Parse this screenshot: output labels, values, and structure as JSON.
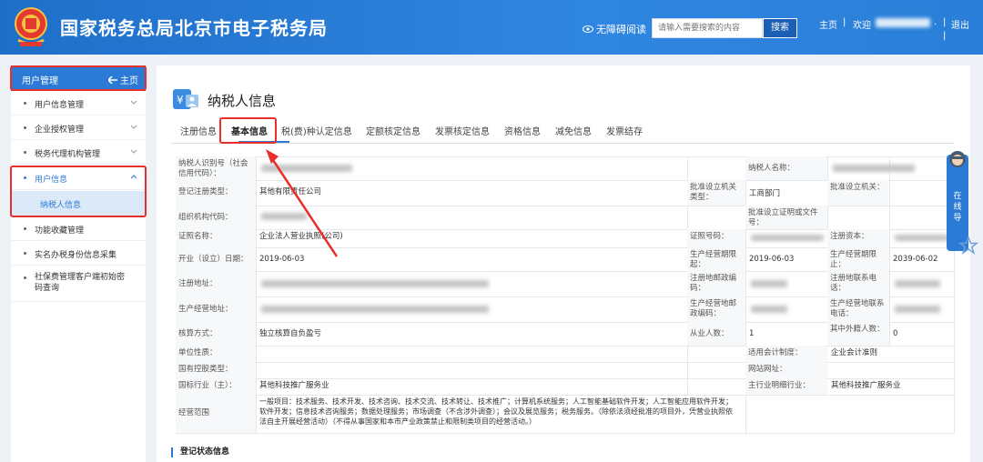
{
  "header": {
    "site_title": "国家税务总局北京市电子税务局",
    "accessibility_label": "无障碍阅读",
    "search_placeholder": "请输入需要搜索的内容",
    "search_button": "搜索",
    "home_link": "主页",
    "welcome_label": "欢迎",
    "logout_link": "退出"
  },
  "sidebar": {
    "title": "用户管理",
    "home_label": "主页",
    "items": [
      {
        "label": "用户信息管理"
      },
      {
        "label": "企业授权管理"
      },
      {
        "label": "税务代理机构管理"
      },
      {
        "label": "用户信息"
      },
      {
        "label": "功能收藏管理"
      },
      {
        "label": "实名办税身份信息采集"
      },
      {
        "label": "社保费管理客户端初始密码查询"
      }
    ],
    "sub_item": "纳税人信息"
  },
  "main": {
    "title": "纳税人信息",
    "tabs": [
      "注册信息",
      "基本信息",
      "税(费)种认定信息",
      "定额核定信息",
      "发票核定信息",
      "资格信息",
      "减免信息",
      "发票结存"
    ],
    "active_tab": "基本信息",
    "section_title": "登记状态信息"
  },
  "table": {
    "taxpayer_id_label": "纳税人识别号（社会信用代码）：",
    "taxpayer_name_label": "纳税人名称：",
    "reg_type_label": "登记注册类型：",
    "reg_type_value": "其他有限责任公司",
    "approve_org_type_label": "批准设立机关类型：",
    "approve_org_type_value": "工商部门",
    "approve_org_label": "批准设立机关：",
    "org_code_label": "组织机构代码：",
    "approve_doc_label": "批准设立证明或文件号：",
    "cert_name_label": "证照名称：",
    "cert_name_value": "企业法人营业执照(公司)",
    "cert_no_label": "证照号码：",
    "capital_label": "注册资本：",
    "open_date_label": "开业（设立）日期：",
    "open_date_value": "2019-06-03",
    "period_start_label": "生产经营期限起：",
    "period_start_value": "2019-06-03",
    "period_end_label": "生产经营期限止：",
    "period_end_value": "2039-06-02",
    "reg_addr_label": "注册地址：",
    "reg_zip_label": "注册地邮政编码：",
    "reg_phone_label": "注册地联系电话：",
    "prod_addr_label": "生产经营地址：",
    "prod_zip_label": "生产经营地邮政编码：",
    "prod_phone_label": "生产经营地联系电话：",
    "accounting_label": "核算方式：",
    "accounting_value": "独立核算自负盈亏",
    "employees_label": "从业人数：",
    "employees_value": "1",
    "foreign_label": "其中外籍人数：",
    "foreign_value": "0",
    "unit_nature_label": "单位性质：",
    "acct_system_label": "适用会计制度：",
    "acct_system_value": "企业会计准则",
    "state_holding_label": "国有控股类型：",
    "website_label": "网站网址：",
    "industry_label": "国标行业（主）：",
    "industry_value": "其他科技推广服务业",
    "detail_industry_label": "主行业明细行业：",
    "detail_industry_value": "其他科技推广服务业",
    "scope_label": "经营范围",
    "scope_value": "一般项目：技术服务、技术开发、技术咨询、技术交流、技术转让、技术推广；计算机系统服务；人工智能基础软件开发；人工智能应用软件开发；软件开发；信息技术咨询服务；数据处理服务；市场调查（不含涉外调查）；会议及展览服务；税务服务。（除依法须经批准的项目外，凭营业执照依法自主开展经营活动）（不得从事国家和本市产业政策禁止和限制类项目的经营活动。）"
  },
  "online_service": {
    "label": "在线导"
  }
}
